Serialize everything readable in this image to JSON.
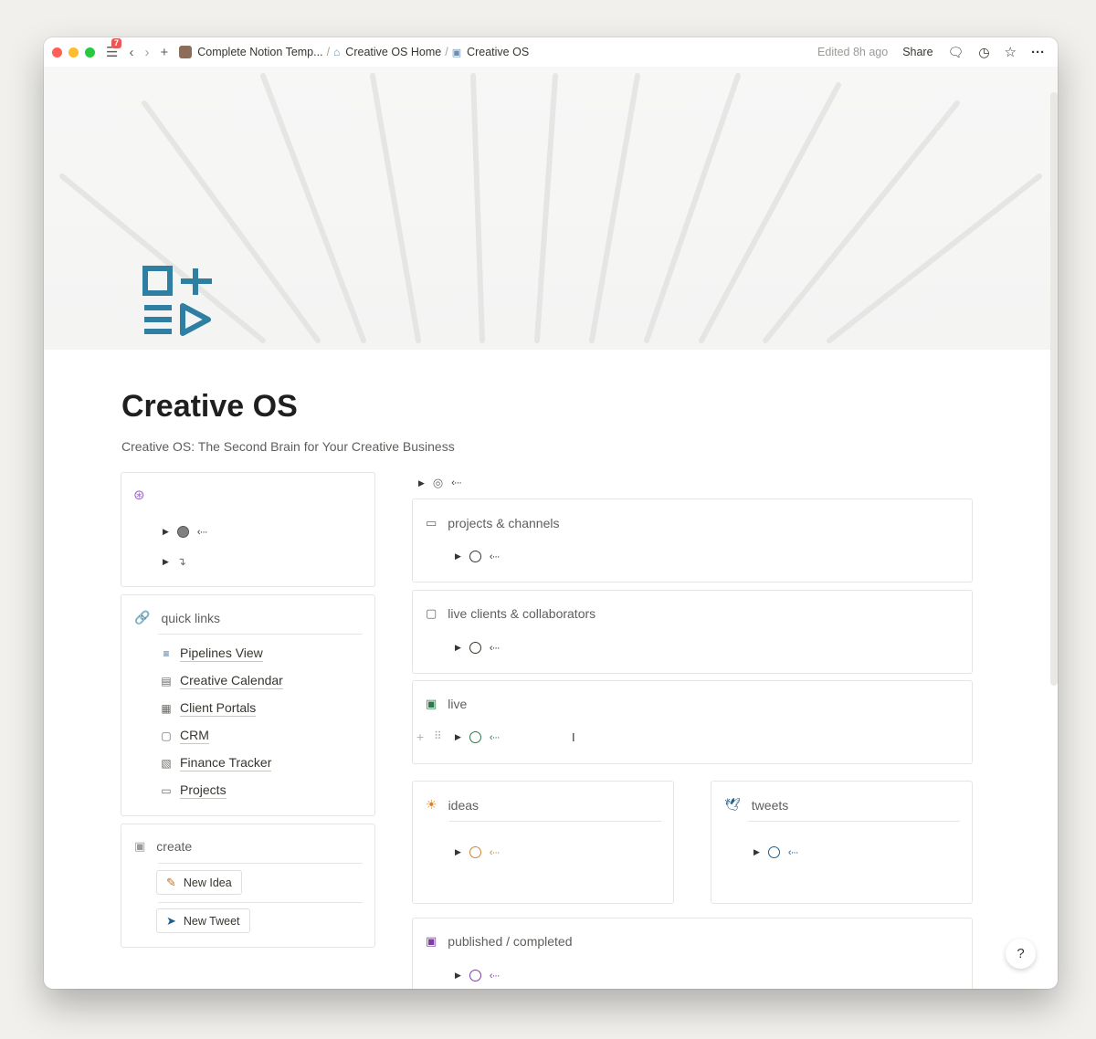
{
  "titlebar": {
    "notif_count": "7",
    "breadcrumbs": [
      "Complete Notion Temp...",
      "Creative OS Home",
      "Creative OS"
    ],
    "separator": "/",
    "edited": "Edited 8h ago",
    "share": "Share"
  },
  "page": {
    "title": "Creative OS",
    "subtitle": "Creative OS: The Second Brain for Your Creative Business",
    "icon_color": "#2f7fa3"
  },
  "left": {
    "quick_links": {
      "header": "quick links",
      "items": [
        "Pipelines View",
        "Creative Calendar",
        "Client Portals",
        "CRM",
        "Finance Tracker",
        "Projects"
      ]
    },
    "create": {
      "header": "create",
      "buttons": [
        "New Idea",
        "New Tweet"
      ]
    }
  },
  "right": {
    "sections": [
      {
        "label": "projects & channels",
        "color": "#37352f"
      },
      {
        "label": "live clients & collaborators",
        "color": "#37352f"
      },
      {
        "label": "live",
        "color": "#2c7a4b"
      },
      {
        "label": "ideas",
        "color": "#d9822b"
      },
      {
        "label": "tweets",
        "color": "#1f5f8b"
      },
      {
        "label": "published / completed",
        "color": "#7b3fa0"
      }
    ]
  },
  "help": "?"
}
